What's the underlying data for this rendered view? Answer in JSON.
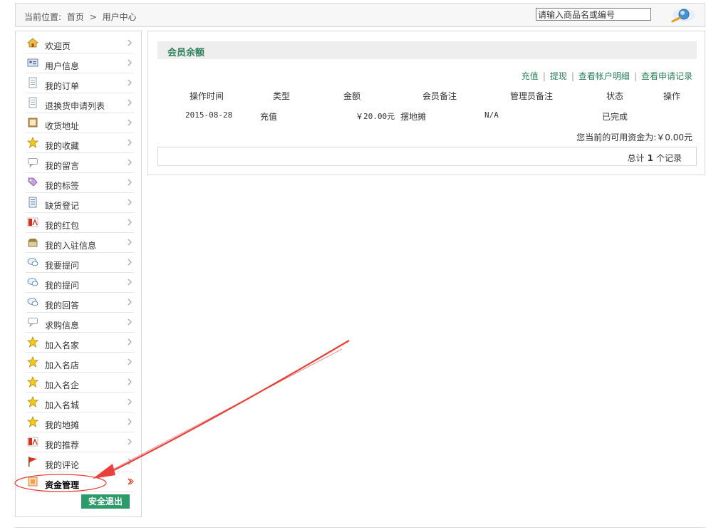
{
  "breadcrumb": {
    "prefix": "当前位置:",
    "home": "首页",
    "sep": ">",
    "current": "用户中心"
  },
  "search": {
    "value": "请输入商品名或编号"
  },
  "sidebar": {
    "items": [
      {
        "label": "欢迎页",
        "icon": "home-icon"
      },
      {
        "label": "用户信息",
        "icon": "id-card-icon"
      },
      {
        "label": "我的订单",
        "icon": "document-icon"
      },
      {
        "label": "退换货申请列表",
        "icon": "document-icon"
      },
      {
        "label": "收货地址",
        "icon": "address-book-icon"
      },
      {
        "label": "我的收藏",
        "icon": "star-icon"
      },
      {
        "label": "我的留言",
        "icon": "speech-bubble-icon"
      },
      {
        "label": "我的标签",
        "icon": "tag-icon"
      },
      {
        "label": "缺货登记",
        "icon": "list-icon"
      },
      {
        "label": "我的红包",
        "icon": "red-envelope-icon"
      },
      {
        "label": "我的入驻信息",
        "icon": "shop-icon"
      },
      {
        "label": "我要提问",
        "icon": "question-bubble-icon"
      },
      {
        "label": "我的提问",
        "icon": "question-bubble-icon"
      },
      {
        "label": "我的回答",
        "icon": "question-bubble-icon"
      },
      {
        "label": "求购信息",
        "icon": "speech-bubble-icon"
      },
      {
        "label": "加入名家",
        "icon": "star-icon"
      },
      {
        "label": "加入名店",
        "icon": "star-icon"
      },
      {
        "label": "加入名企",
        "icon": "star-icon"
      },
      {
        "label": "加入名城",
        "icon": "star-icon"
      },
      {
        "label": "我的地摊",
        "icon": "star-icon"
      },
      {
        "label": "我的推荐",
        "icon": "red-envelope-icon"
      },
      {
        "label": "我的评论",
        "icon": "flag-icon"
      },
      {
        "label": "资金管理",
        "icon": "money-icon",
        "active": true
      }
    ],
    "logout": "安全退出"
  },
  "main": {
    "title": "会员余额",
    "actions": {
      "recharge": "充值",
      "withdraw": "提现",
      "account_detail": "查看帐户明细",
      "apply_record": "查看申请记录",
      "sep": "|"
    },
    "table": {
      "headers": [
        "操作时间",
        "类型",
        "金额",
        "会员备注",
        "管理员备注",
        "状态",
        "操作"
      ],
      "rows": [
        {
          "time": "2015-08-28",
          "type": "充值",
          "amount": "￥20.00元",
          "member_note": "摆地摊",
          "admin_note": "N/A",
          "status": "已完成",
          "operation": ""
        }
      ]
    },
    "summary": "您当前的可用资金为:￥0.00元",
    "pager": {
      "prefix": "总计",
      "count": "1",
      "suffix": "个记录"
    }
  },
  "colors": {
    "accent": "#2a7f5a",
    "button": "#2d9a6a",
    "annotation": "#e8403a"
  }
}
